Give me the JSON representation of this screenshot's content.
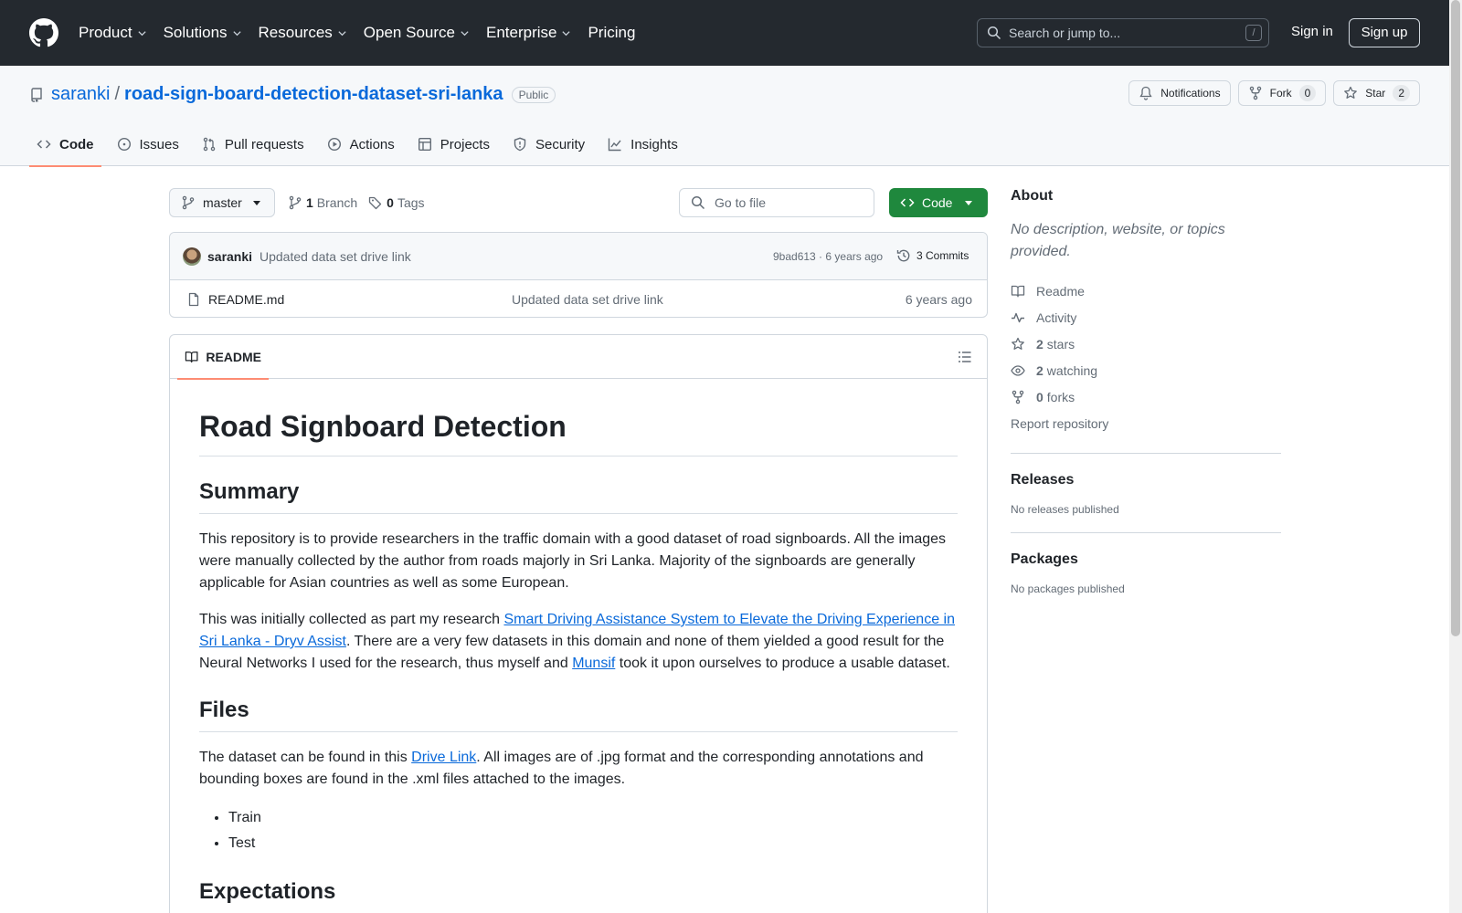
{
  "header": {
    "nav": [
      {
        "label": "Product",
        "chevron": true
      },
      {
        "label": "Solutions",
        "chevron": true
      },
      {
        "label": "Resources",
        "chevron": true
      },
      {
        "label": "Open Source",
        "chevron": true
      },
      {
        "label": "Enterprise",
        "chevron": true
      },
      {
        "label": "Pricing",
        "chevron": false
      }
    ],
    "search_placeholder": "Search or jump to...",
    "search_shortcut": "/",
    "sign_in": "Sign in",
    "sign_up": "Sign up"
  },
  "repo": {
    "owner": "saranki",
    "separator": "/",
    "name": "road-sign-board-detection-dataset-sri-lanka",
    "visibility": "Public",
    "notifications_label": "Notifications",
    "fork_label": "Fork",
    "fork_count": "0",
    "star_label": "Star",
    "star_count": "2"
  },
  "tabs": [
    {
      "label": "Code",
      "icon": "code-icon",
      "active": true
    },
    {
      "label": "Issues",
      "icon": "issue-icon",
      "active": false
    },
    {
      "label": "Pull requests",
      "icon": "pull-request-icon",
      "active": false
    },
    {
      "label": "Actions",
      "icon": "play-icon",
      "active": false
    },
    {
      "label": "Projects",
      "icon": "table-icon",
      "active": false
    },
    {
      "label": "Security",
      "icon": "shield-icon",
      "active": false
    },
    {
      "label": "Insights",
      "icon": "graph-icon",
      "active": false
    }
  ],
  "branchbar": {
    "branch": "master",
    "branch_count": "1",
    "branch_label": "Branch",
    "tag_count": "0",
    "tag_label": "Tags",
    "goto_placeholder": "Go to file",
    "code_label": "Code"
  },
  "commit": {
    "author": "saranki",
    "message": "Updated data set drive link",
    "hash_time": "9bad613 · 6 years ago",
    "commits_label": "3 Commits"
  },
  "files": [
    {
      "name": "README.md",
      "message": "Updated data set drive link",
      "time": "6 years ago"
    }
  ],
  "readme": {
    "tab_label": "README",
    "title": "Road Signboard Detection",
    "summary_heading": "Summary",
    "summary_p1": "This repository is to provide researchers in the traffic domain with a good dataset of road signboards. All the images were manually collected by the author from roads majorly in Sri Lanka. Majority of the signboards are generally applicable for Asian countries as well as some European.",
    "summary_p2_pre": "This was initially collected as part my research ",
    "summary_p2_link": "Smart Driving Assistance System to Elevate the Driving Experience in Sri Lanka - Dryv Assist",
    "summary_p2_mid": ". There are a very few datasets in this domain and none of them yielded a good result for the Neural Networks I used for the research, thus myself and ",
    "summary_p2_link2": "Munsif",
    "summary_p2_post": " took it upon ourselves to produce a usable dataset.",
    "files_heading": "Files",
    "files_p_pre": "The dataset can be found in this ",
    "files_p_link": "Drive Link",
    "files_p_post": ". All images are of .jpg format and the corresponding annotations and bounding boxes are found in the .xml files attached to the images.",
    "files_list": [
      "Train",
      "Test"
    ],
    "expectations_heading": "Expectations"
  },
  "sidebar": {
    "about_heading": "About",
    "about_desc": "No description, website, or topics provided.",
    "readme_label": "Readme",
    "activity_label": "Activity",
    "stars_count": "2",
    "stars_label": "stars",
    "watching_count": "2",
    "watching_label": "watching",
    "forks_count": "0",
    "forks_label": "forks",
    "report_label": "Report repository",
    "releases_heading": "Releases",
    "releases_none": "No releases published",
    "packages_heading": "Packages",
    "packages_none": "No packages published"
  }
}
